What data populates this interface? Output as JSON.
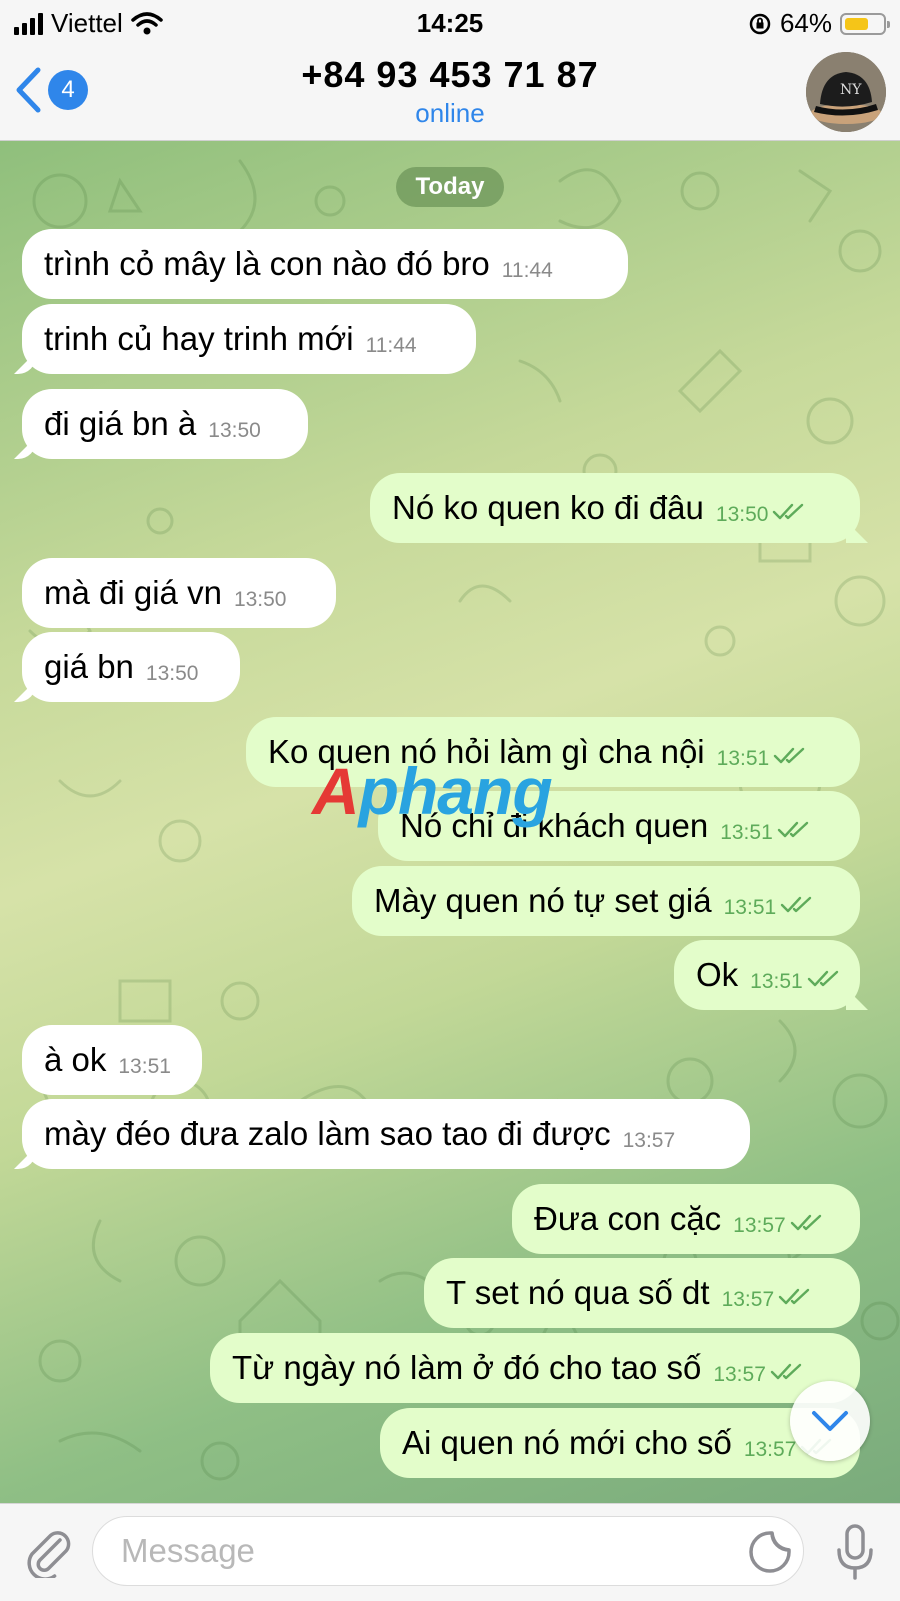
{
  "status_bar": {
    "carrier": "Viettel",
    "time": "14:25",
    "battery": "64%",
    "battery_level": 0.64
  },
  "header": {
    "back_badge": "4",
    "title": "+84 93 453 71 87",
    "subtitle": "online"
  },
  "chat": {
    "date_label": "Today",
    "messages": [
      {
        "dir": "in",
        "text": "trình cỏ mây là con nào đó bro",
        "time": "11:44"
      },
      {
        "dir": "in",
        "text": "trinh củ hay trinh mới",
        "time": "11:44"
      },
      {
        "dir": "in",
        "text": "đi giá bn à",
        "time": "13:50"
      },
      {
        "dir": "out",
        "text": "Nó ko quen ko đi đâu",
        "time": "13:50"
      },
      {
        "dir": "in",
        "text": "mà đi giá vn",
        "time": "13:50"
      },
      {
        "dir": "in",
        "text": "giá bn",
        "time": "13:50"
      },
      {
        "dir": "out",
        "text": "Ko quen nó hỏi làm gì cha nội",
        "time": "13:51"
      },
      {
        "dir": "out",
        "text": "Nó chỉ đi khách quen",
        "time": "13:51"
      },
      {
        "dir": "out",
        "text": "Mày quen nó tự set giá",
        "time": "13:51"
      },
      {
        "dir": "out",
        "text": "Ok",
        "time": "13:51"
      },
      {
        "dir": "in",
        "text": "à ok",
        "time": "13:51"
      },
      {
        "dir": "in",
        "text": "mày đéo đưa zalo làm sao tao đi được",
        "time": "13:57"
      },
      {
        "dir": "out",
        "text": "Đưa con cặc",
        "time": "13:57"
      },
      {
        "dir": "out",
        "text": "T set nó qua số dt",
        "time": "13:57"
      },
      {
        "dir": "out",
        "text": "Từ ngày nó làm ở đó cho tao số",
        "time": "13:57"
      },
      {
        "dir": "out",
        "text": "Ai quen nó mới cho số",
        "time": "13:57"
      }
    ]
  },
  "watermark": {
    "part1": "A",
    "part2": "phang"
  },
  "input": {
    "placeholder": "Message"
  },
  "colors": {
    "accent": "#2f86ea",
    "outgoing_bubble": "#e3fdca",
    "incoming_bubble": "#ffffff",
    "read_ticks": "#5eab5a"
  },
  "icons": [
    "signal-icon",
    "wifi-icon",
    "orientation-lock-icon",
    "battery-icon",
    "back-chevron-icon",
    "avatar-cap-icon",
    "scroll-down-icon",
    "attach-icon",
    "sticker-icon",
    "mic-icon"
  ]
}
